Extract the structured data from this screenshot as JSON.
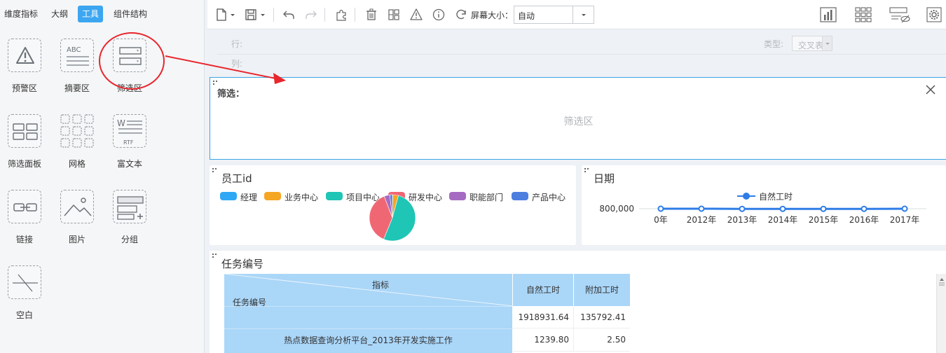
{
  "left_panel": {
    "tabs": [
      {
        "label": "维度指标",
        "active": false
      },
      {
        "label": "大纲",
        "active": false
      },
      {
        "label": "工具",
        "active": true
      },
      {
        "label": "组件结构",
        "active": false
      }
    ],
    "tools": [
      {
        "label": "预警区",
        "icon": "warning-icon"
      },
      {
        "label": "摘要区",
        "icon": "abc-text-icon"
      },
      {
        "label": "筛选区",
        "icon": "filter-area-icon"
      },
      {
        "label": "筛选面板",
        "icon": "filter-panel-icon"
      },
      {
        "label": "网格",
        "icon": "grid-icon"
      },
      {
        "label": "富文本",
        "icon": "rich-text-icon"
      },
      {
        "label": "链接",
        "icon": "link-icon"
      },
      {
        "label": "图片",
        "icon": "image-icon"
      },
      {
        "label": "分组",
        "icon": "group-icon"
      },
      {
        "label": "空白",
        "icon": "blank-icon"
      }
    ]
  },
  "toolbar": {
    "screen_size_label": "屏幕大小：",
    "screen_size_value": "自动"
  },
  "layout_rows": {
    "row_label": "行:",
    "col_label": "列:",
    "type_label": "类型:",
    "type_value": "交叉表"
  },
  "filter_widget": {
    "title": "筛选：",
    "placeholder": "筛选区"
  },
  "employee_widget": {
    "title": "员工id",
    "legend": [
      {
        "name": "经理",
        "color": "#2ea8f5"
      },
      {
        "name": "业务中心",
        "color": "#f5a623"
      },
      {
        "name": "项目中心",
        "color": "#1fc5b5"
      },
      {
        "name": "研发中心",
        "color": "#f06774"
      },
      {
        "name": "职能部门",
        "color": "#a56bc2"
      },
      {
        "name": "产品中心",
        "color": "#4d7fe0"
      }
    ]
  },
  "date_widget": {
    "title": "日期",
    "legend_label": "自然工时"
  },
  "chart_data": [
    {
      "type": "pie",
      "title": "员工id",
      "categories": [
        "经理",
        "业务中心",
        "项目中心",
        "研发中心",
        "职能部门",
        "产品中心"
      ],
      "values": [
        0.2,
        4,
        52,
        38,
        4,
        1.8
      ],
      "colors": [
        "#2ea8f5",
        "#f5a623",
        "#1fc5b5",
        "#f06774",
        "#a56bc2",
        "#4d7fe0"
      ]
    },
    {
      "type": "line",
      "title": "日期",
      "categories": [
        "0年",
        "2012年",
        "2013年",
        "2014年",
        "2015年",
        "2016年",
        "2017年"
      ],
      "series": [
        {
          "name": "自然工时",
          "values": [
            800000,
            800000,
            790000,
            790000,
            790000,
            790000,
            800000
          ]
        }
      ],
      "ytick_label": "800,000",
      "color": "#2e7de6"
    }
  ],
  "task_widget": {
    "title": "任务编号",
    "corner_top": "指标",
    "corner_bottom": "任务编号",
    "columns": [
      "自然工时",
      "附加工时"
    ],
    "rows": [
      {
        "label": "",
        "values": [
          "1918931.64",
          "135792.41"
        ]
      },
      {
        "label": "热点数据查询分析平台_2013年开发实施工作",
        "values": [
          "1239.80",
          "2.50"
        ]
      }
    ]
  }
}
